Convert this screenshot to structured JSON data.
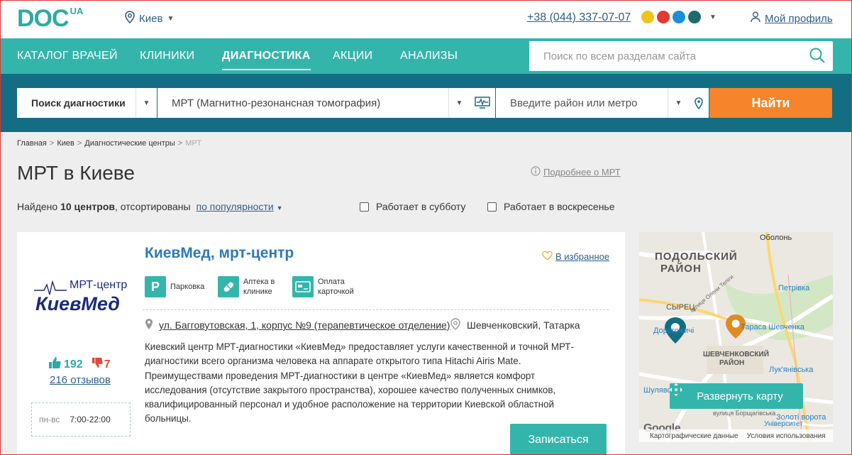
{
  "header": {
    "logo_text": "DOC",
    "logo_suffix": "UA",
    "city": "Киев",
    "phone": "+38 (044) 337-07-07",
    "profile": "Мой профиль"
  },
  "nav": {
    "items": [
      "КАТАЛОГ ВРАЧЕЙ",
      "КЛИНИКИ",
      "ДИАГНОСТИКА",
      "АКЦИИ",
      "АНАЛИЗЫ"
    ],
    "active": "ДИАГНОСТИКА",
    "search_placeholder": "Поиск по всем разделам сайта"
  },
  "filters": {
    "type": "Поиск диагностики",
    "service": "МРТ (Магнитно-резонансная томография)",
    "location_placeholder": "Введите район или метро",
    "find_button": "Найти"
  },
  "breadcrumbs": [
    "Главная",
    "Киев",
    "Диагностические центры",
    "МРТ"
  ],
  "page": {
    "title": "МРТ в Киеве",
    "more_link": "Подробнее о МРТ",
    "found_prefix": "Найдено ",
    "found_count": "10 центров",
    "found_suffix": ", отсортированы",
    "sort": "по популярности",
    "saturday": "Работает в субботу",
    "sunday": "Работает в воскресенье"
  },
  "clinic": {
    "logo_line1": "МРТ-центр",
    "logo_line2": "КиевМед",
    "name": "КиевМед, мрт-центр",
    "favorite": "В избранное",
    "features": [
      {
        "icon": "P",
        "label": "Парковка"
      },
      {
        "icon": "pill",
        "label": "Аптека в клинике"
      },
      {
        "icon": "card",
        "label": "Оплата карточкой"
      }
    ],
    "address": "ул. Багговутовская, 1, корпус №9 (терапевтическое отделение)",
    "district": "Шевченковский, Татарка",
    "description": "Киевский центр МРТ-диагностики «КиевМед» предоставляет услуги качественной и точной МРТ-диагностики всего организма человека на аппарате открытого типа Hitachi Airis Mate. Преимуществами проведения МРТ-диагностики в центре «КиевМед» является комфорт исследования (отсутствие закрытого пространства), хорошее качество полученных снимков, квалифицированный персонал и удобное расположение на территории Киевской областной больницы.",
    "likes": "192",
    "dislikes": "7",
    "reviews": "216 отзывов",
    "hours_days": "пн-вс",
    "hours_time": "7:00-22:00",
    "book_button": "Записаться"
  },
  "map": {
    "labels": {
      "obolon": "Оболонь",
      "podilskyi_1": "ПОДОЛЬСКИЙ",
      "podilskyi_2": "РАЙОН",
      "petrivka": "Петрівка",
      "syrets": "СЫРЕЦ",
      "dorohozhychi": "Дорогожичі",
      "tarasa": "Тараса Шевченка",
      "shevchenkivskyi_1": "ШЕВЧЕНКОВСКИЙ",
      "shevchenkivskyi_2": "РАЙОН",
      "lukianivska": "Лук'янівська",
      "shuliavska": "Шулявська",
      "zoloti": "Золоті ворота",
      "olena_teliha": "вулиця Олени Теліги",
      "borshchahivska": "вулиця Борщагівська",
      "university": "Університет"
    },
    "expand_button": "Развернуть карту",
    "footer_data": "Картографические данные",
    "footer_terms": "Условия использования",
    "google": "Google"
  },
  "colors": {
    "teal": "#34b5ac",
    "dark_teal": "#136e83",
    "orange": "#f5842a",
    "link": "#2f5f8a"
  }
}
